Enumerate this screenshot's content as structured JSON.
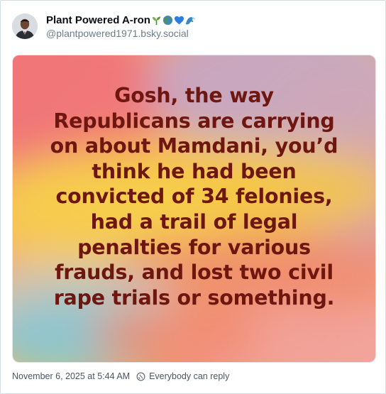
{
  "author": {
    "display_name": "Plant Powered A-ron",
    "handle": "@plantpowered1971.bsky.social",
    "name_emojis": [
      "seedling-icon",
      "globe-icon",
      "blue-heart-icon",
      "wave-icon"
    ]
  },
  "post": {
    "image_text_lines": [
      "Gosh, the way",
      "Republicans are carrying",
      "on about Mamdani, you’d",
      "think he had been",
      "convicted of 34 felonies,",
      "had a trail of legal",
      "penalties for various",
      "frauds, and lost two civil",
      "rape trials or something."
    ],
    "image_text_color": "#6e1610"
  },
  "footer": {
    "timestamp": "November 6, 2025 at 5:44 AM",
    "reply_setting": "Everybody can reply"
  }
}
